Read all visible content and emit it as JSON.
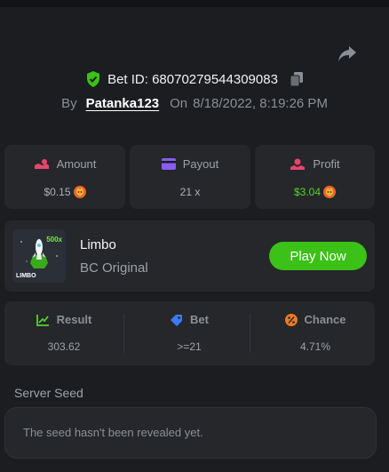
{
  "header": {
    "bet_id_label": "Bet ID:",
    "bet_id": "68070279544309083",
    "by_label": "By",
    "username": "Patanka123",
    "on_label": "On",
    "datetime": "8/18/2022, 8:19:26 PM"
  },
  "stats": {
    "amount": {
      "label": "Amount",
      "value": "$0.15"
    },
    "payout": {
      "label": "Payout",
      "value": "21 x"
    },
    "profit": {
      "label": "Profit",
      "value": "$3.04"
    }
  },
  "game": {
    "name": "Limbo",
    "subtitle": "BC Original",
    "thumb_text": "LIMBO",
    "thumb_badge": "500x",
    "play_label": "Play Now"
  },
  "result": {
    "result": {
      "label": "Result",
      "value": "303.62"
    },
    "bet": {
      "label": "Bet",
      "value": ">=21"
    },
    "chance": {
      "label": "Chance",
      "value": "4.71%"
    }
  },
  "seed": {
    "label": "Server Seed",
    "text": "The seed hasn't been revealed yet."
  },
  "colors": {
    "accent_green": "#3bc117",
    "profit_green": "#54d32a",
    "background": "#1b1d20",
    "card": "#25272b"
  },
  "icons": [
    "share-icon",
    "shield-check-icon",
    "copy-icon",
    "amount-icon",
    "payout-icon",
    "profit-icon",
    "coin-icon",
    "result-icon",
    "bet-icon",
    "chance-icon"
  ]
}
